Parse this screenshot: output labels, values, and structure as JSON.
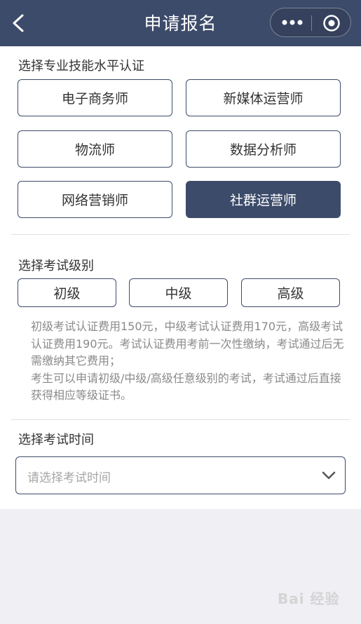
{
  "header": {
    "title": "申请报名"
  },
  "skills": {
    "label": "选择专业技能水平认证",
    "items": [
      "电子商务师",
      "新媒体运营师",
      "物流师",
      "数据分析师",
      "网络营销师",
      "社群运营师"
    ],
    "selected": "社群运营师"
  },
  "levels": {
    "label": "选择考试级别",
    "items": [
      "初级",
      "中级",
      "高级"
    ]
  },
  "description": [
    "初级考试认证费用150元，中级考试认证费用170元，高级考试认证费用190元。考试认证费用考前一次性缴纳，考试通过后无需缴纳其它费用；",
    "考生可以申请初级/中级/高级任意级别的考试，考试通过后直接获得相应等级证书。"
  ],
  "exam_time": {
    "label": "选择考试时间",
    "placeholder": "请选择考试时间"
  },
  "watermark": "Bai 经验"
}
